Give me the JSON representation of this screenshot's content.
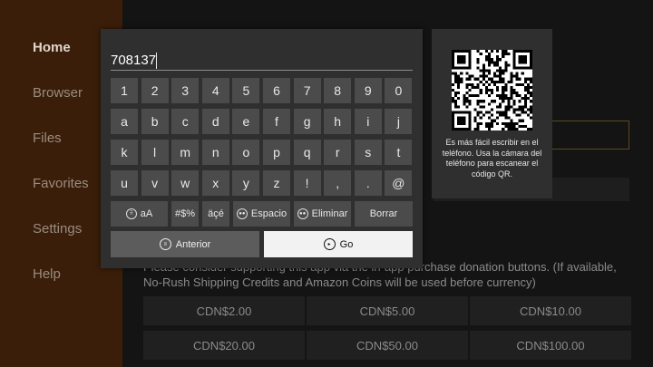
{
  "sidebar": {
    "items": [
      {
        "label": "Home",
        "active": true
      },
      {
        "label": "Browser",
        "active": false
      },
      {
        "label": "Files",
        "active": false
      },
      {
        "label": "Favorites",
        "active": false
      },
      {
        "label": "Settings",
        "active": false
      },
      {
        "label": "Help",
        "active": false
      }
    ]
  },
  "background": {
    "description": "Please consider supporting this app via the in-app purchase donation buttons. (If available, No-Rush Shipping Credits and Amazon Coins will be used before currency)",
    "donations": [
      "CDN$2.00",
      "CDN$5.00",
      "CDN$10.00",
      "CDN$20.00",
      "CDN$50.00",
      "CDN$100.00"
    ]
  },
  "keyboard": {
    "input_value": "708137",
    "rows": [
      [
        "1",
        "2",
        "3",
        "4",
        "5",
        "6",
        "7",
        "8",
        "9",
        "0"
      ],
      [
        "a",
        "b",
        "c",
        "d",
        "e",
        "f",
        "g",
        "h",
        "i",
        "j"
      ],
      [
        "k",
        "l",
        "m",
        "n",
        "o",
        "p",
        "q",
        "r",
        "s",
        "t"
      ],
      [
        "u",
        "v",
        "w",
        "x",
        "y",
        "z",
        "!",
        ",",
        ".",
        "@"
      ]
    ],
    "special_keys": {
      "case": "aA",
      "symbols": "#$%",
      "accents": "äçé",
      "space": "Espacio",
      "delete": "Eliminar",
      "clear": "Borrar"
    },
    "prev_label": "Anterior",
    "go_label": "Go"
  },
  "qr": {
    "text": "Es más fácil escribir en el teléfono. Usa la cámara del teléfono para escanear el código QR."
  },
  "colors": {
    "sidebar_bg": "#3a1e09",
    "panel_bg": "#2f2f2f",
    "key_bg": "#4b4b4b",
    "go_bg": "#f2f2f2"
  }
}
